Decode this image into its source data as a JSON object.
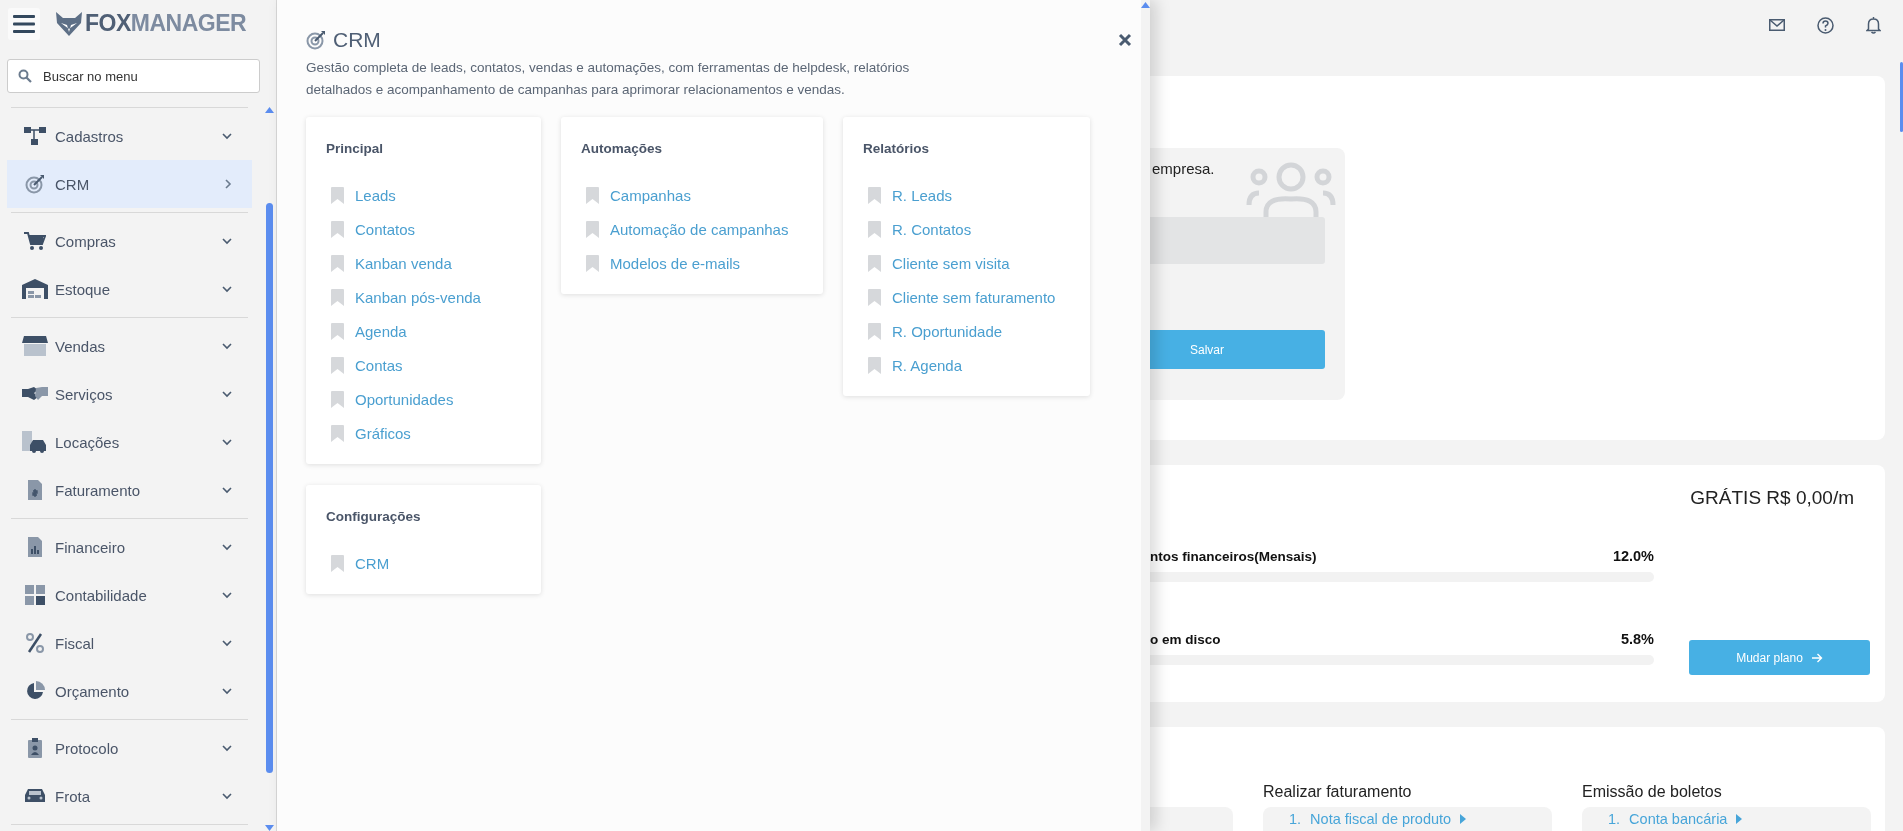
{
  "sidebar": {
    "logo": [
      "FOX",
      "MANAGER"
    ],
    "search": {
      "placeholder": "Buscar no menu"
    },
    "groups": [
      {
        "items": [
          {
            "label": "Cadastros",
            "selected": false
          },
          {
            "label": "CRM",
            "selected": true
          }
        ]
      },
      {
        "items": [
          {
            "label": "Compras",
            "selected": false
          },
          {
            "label": "Estoque",
            "selected": false
          }
        ]
      },
      {
        "items": [
          {
            "label": "Vendas",
            "selected": false
          },
          {
            "label": "Serviços",
            "selected": false
          },
          {
            "label": "Locações",
            "selected": false
          },
          {
            "label": "Faturamento",
            "selected": false
          }
        ]
      },
      {
        "items": [
          {
            "label": "Financeiro",
            "selected": false
          },
          {
            "label": "Contabilidade",
            "selected": false
          },
          {
            "label": "Fiscal",
            "selected": false
          },
          {
            "label": "Orçamento",
            "selected": false
          }
        ]
      },
      {
        "items": [
          {
            "label": "Protocolo",
            "selected": false
          },
          {
            "label": "Frota",
            "selected": false
          }
        ]
      }
    ]
  },
  "panel": {
    "title": "CRM",
    "description": "Gestão completa de leads, contatos, vendas e automações, com ferramentas de helpdesk, relatórios detalhados e acompanhamento de campanhas para aprimorar relacionamentos e vendas.",
    "columns": [
      [
        {
          "heading": "Principal",
          "links": [
            "Leads",
            "Contatos",
            "Kanban venda",
            "Kanban pós-venda",
            "Agenda",
            "Contas",
            "Oportunidades",
            "Gráficos"
          ]
        },
        {
          "heading": "Configurações",
          "links": [
            "CRM"
          ]
        }
      ],
      [
        {
          "heading": "Automações",
          "links": [
            "Campanhas",
            "Automação de campanhas",
            "Modelos de e-mails"
          ]
        }
      ],
      [
        {
          "heading": "Relatórios",
          "links": [
            "R. Leads",
            "R. Contatos",
            "Cliente sem visita",
            "Cliente sem faturamento",
            "R. Oportunidade",
            "R. Agenda"
          ]
        }
      ]
    ]
  },
  "main": {
    "setup_card": {
      "text": "empresa.",
      "button": "Salvar"
    },
    "plan_card": {
      "price": "GRÁTIS R$ 0,00/m",
      "meters": [
        {
          "label": "ntos financeiros(Mensais)",
          "reading": "12.0%"
        },
        {
          "label": "o em disco",
          "reading": "5.8%"
        }
      ],
      "button": "Mudar plano"
    },
    "steps_card": {
      "groups": [
        {
          "title": "Realizar faturamento",
          "items": [
            {
              "number": "1.",
              "label": "Nota fiscal de produto"
            }
          ]
        },
        {
          "title": "Emissão de boletos",
          "items": [
            {
              "number": "1.",
              "label": "Conta bancária"
            }
          ]
        }
      ]
    }
  }
}
